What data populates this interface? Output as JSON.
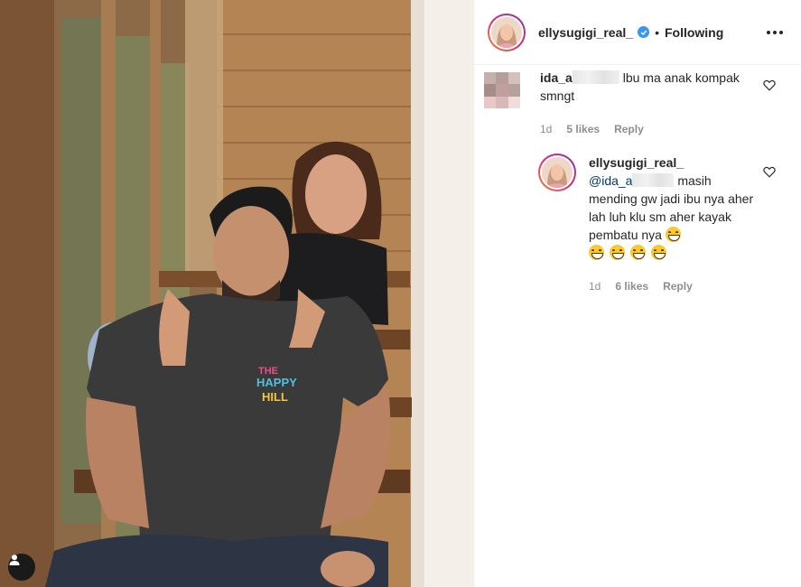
{
  "header": {
    "username": "ellysugigi_real_",
    "separator": "•",
    "follow_state": "Following",
    "more_icon": "more-horizontal-icon"
  },
  "comments": [
    {
      "username": "ida_a",
      "text": "lbu ma anak kompak smngt",
      "time": "1d",
      "likes": "5 likes",
      "reply_label": "Reply",
      "heart_icon": "heart-outline-icon"
    }
  ],
  "replies": [
    {
      "username": "ellysugigi_real_",
      "mention": "@ida_a",
      "text": "masih mending gw jadi ibu nya aher lah luh klu sm aher kayak pembatu nya",
      "emoji": [
        "😂",
        "😂",
        "😂",
        "😂",
        "😂"
      ],
      "time": "1d",
      "likes": "6 likes",
      "reply_label": "Reply",
      "heart_icon": "heart-outline-icon"
    }
  ],
  "photo": {
    "shirt_print": [
      "THE",
      "HAPPY",
      "HILL"
    ],
    "tag_icon": "user-tag-icon"
  },
  "colors": {
    "accent": "#3897f0",
    "story_ring_start": "#f58529",
    "story_ring_end": "#8134af"
  }
}
